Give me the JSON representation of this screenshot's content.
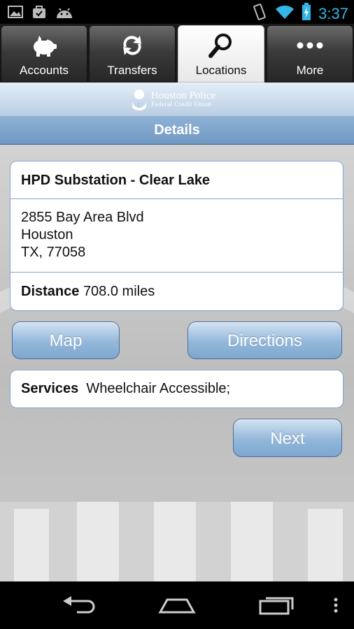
{
  "status_bar": {
    "time": "3:37",
    "left_icons": [
      "gallery-icon",
      "checkbag-icon",
      "android-icon"
    ],
    "right_icons": [
      "vibrate-icon",
      "wifi-icon",
      "battery-charging-icon"
    ],
    "time_color": "#33b5e5"
  },
  "tabs": [
    {
      "label": "Accounts",
      "icon": "piggy-bank-icon",
      "active": false
    },
    {
      "label": "Transfers",
      "icon": "transfer-arrows-icon",
      "active": false
    },
    {
      "label": "Locations",
      "icon": "magnifier-icon",
      "active": true
    },
    {
      "label": "More",
      "icon": "more-dots-icon",
      "active": false
    }
  ],
  "header": {
    "logo_line1": "Houston Police",
    "logo_line2": "Federal Credit Union",
    "title": "Details"
  },
  "location": {
    "name": "HPD Substation - Clear Lake",
    "address_line1": "2855 Bay Area Blvd",
    "address_line2": "Houston",
    "address_line3": "TX, 77058",
    "distance_label": "Distance",
    "distance_value": "708.0 miles"
  },
  "buttons": {
    "map": "Map",
    "directions": "Directions",
    "next": "Next"
  },
  "services": {
    "label": "Services",
    "value": "Wheelchair Accessible;"
  },
  "colors": {
    "accent_blue": "#7fa7d0",
    "button_blue": "#93b7da"
  }
}
